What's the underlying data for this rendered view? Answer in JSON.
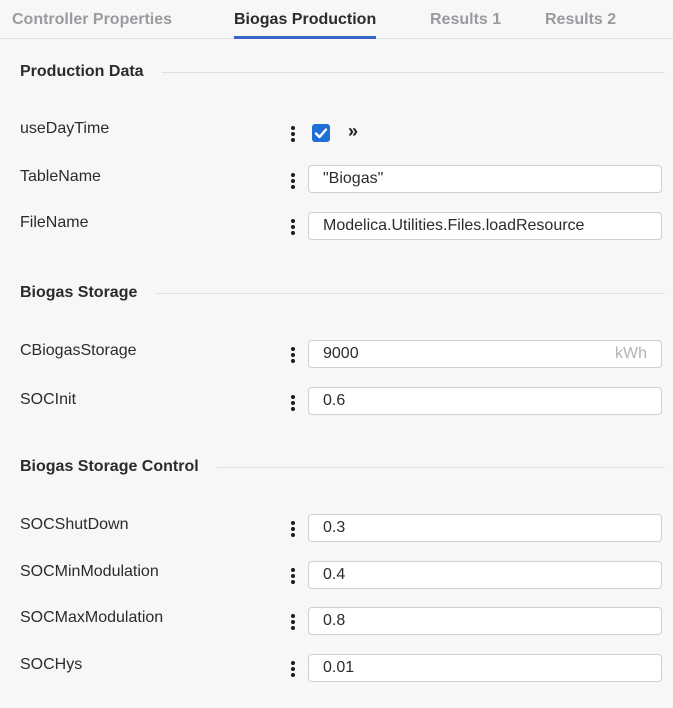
{
  "tabs": [
    {
      "label": "Controller Properties",
      "active": false
    },
    {
      "label": "Biogas Production",
      "active": true
    },
    {
      "label": "Results 1",
      "active": false
    },
    {
      "label": "Results 2",
      "active": false
    }
  ],
  "sections": {
    "production_data": "Production Data",
    "biogas_storage": "Biogas Storage",
    "biogas_storage_control": "Biogas Storage Control"
  },
  "params": {
    "useDayTime": {
      "label": "useDayTime",
      "checked": true,
      "expand_glyph": "»"
    },
    "TableName": {
      "label": "TableName",
      "value": "\"Biogas\""
    },
    "FileName": {
      "label": "FileName",
      "value": "Modelica.Utilities.Files.loadResource"
    },
    "CBiogasStorage": {
      "label": "CBiogasStorage",
      "value": "9000",
      "unit": "kWh"
    },
    "SOCInit": {
      "label": "SOCInit",
      "value": "0.6"
    },
    "SOCShutDown": {
      "label": "SOCShutDown",
      "value": "0.3"
    },
    "SOCMinModulation": {
      "label": "SOCMinModulation",
      "value": "0.4"
    },
    "SOCMaxModulation": {
      "label": "SOCMaxModulation",
      "value": "0.8"
    },
    "SOCHys": {
      "label": "SOCHys",
      "value": "0.01"
    }
  },
  "icons": {
    "menu": "kebab-menu-icon",
    "check": "check-icon",
    "expand": "double-chevron-right-icon"
  },
  "colors": {
    "accent": "#3866c8",
    "checkbox": "#1f6fd6",
    "text": "#2b2b2b",
    "muted": "#9a9a9f"
  }
}
